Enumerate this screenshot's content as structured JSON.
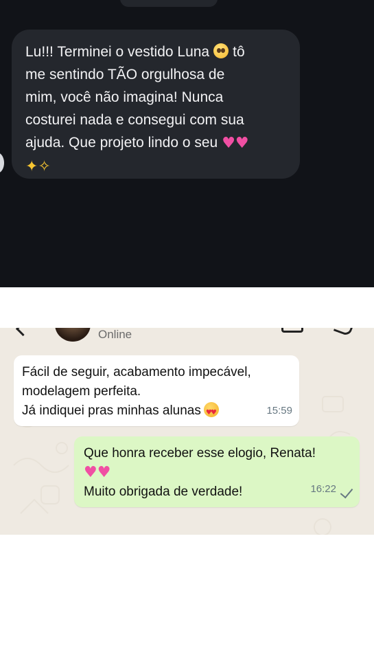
{
  "dark_chat": {
    "message_lines": [
      "Lu!!! Terminei o vestido Luna",
      "tô",
      "me sentindo TÃO orgulhosa de",
      "mim, você não imagina! Nunca",
      "costurei nada e consegui com sua",
      "ajuda. Que projeto lindo o seu"
    ],
    "emoji": {
      "pleading": "🥺",
      "hearts": "💕",
      "sparkles": "✨"
    },
    "bubble_color": "#24272d",
    "background_color": "#111318"
  },
  "whatsapp": {
    "contact_status": "Online",
    "incoming": {
      "lines": [
        "Fácil de seguir, acabamento impecável,",
        "modelagem perfeita.",
        "Já indiquei pras minhas alunas"
      ],
      "emoji": "😍",
      "time": "15:59"
    },
    "outgoing": {
      "lines": [
        "Que honra receber esse elogio, Renata!",
        "Muito obrigada de verdade!"
      ],
      "emoji": "💕",
      "time": "16:22",
      "check_icon": "single-check-icon"
    },
    "colors": {
      "chat_background": "#efeae2",
      "incoming_bubble": "#ffffff",
      "outgoing_bubble": "#dcf7c5"
    }
  }
}
